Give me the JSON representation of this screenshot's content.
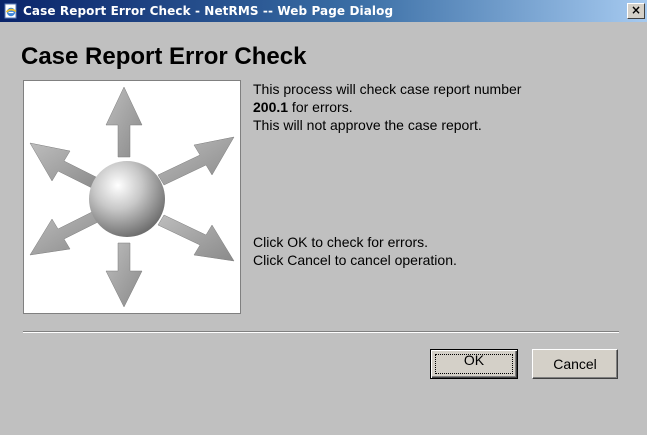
{
  "window": {
    "title": "Case Report Error Check - NetRMS -- Web Page Dialog",
    "close_glyph": "×",
    "icon": "ie-page-icon"
  },
  "dialog": {
    "heading": "Case Report Error Check",
    "image_icon": "directional-arrows-sphere-icon",
    "message": {
      "line1": "This process will check case report number",
      "case_number": "200.1",
      "line2_suffix": " for errors.",
      "line3": "This will not approve the case report.",
      "instruction1": "Click OK to check for errors.",
      "instruction2": "Click Cancel to cancel operation."
    }
  },
  "buttons": {
    "ok_label": "OK",
    "cancel_label": "Cancel"
  },
  "colors": {
    "dialog_bg": "#c0c0c0",
    "titlebar_start": "#0a246a",
    "titlebar_end": "#a6caf0"
  }
}
